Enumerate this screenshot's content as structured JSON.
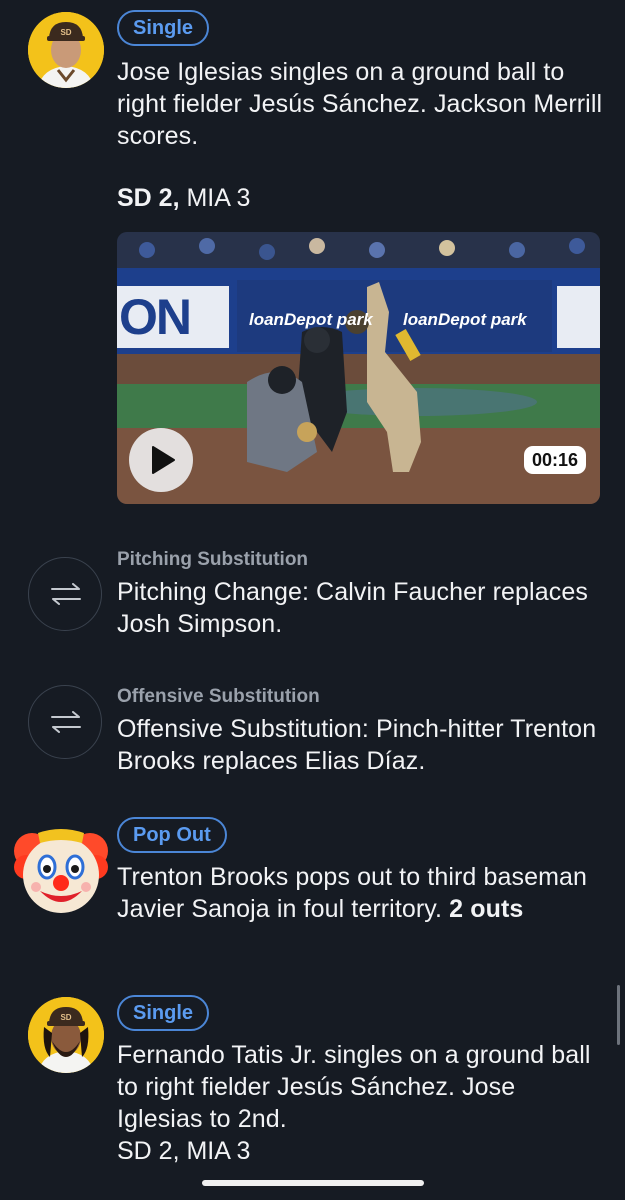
{
  "events": [
    {
      "badge": "Single",
      "description": "Jose Iglesias singles on a ground ball to right fielder Jesús Sánchez. Jackson Merrill scores.",
      "score_sd": "SD 2,",
      "score_mia": "MIA 3",
      "player_avatar": "padres-player-avatar",
      "video": {
        "duration": "00:16",
        "stadium_sign_1": "loanDepot park",
        "stadium_sign_2": "loanDepot park",
        "wall_text": "ON"
      }
    },
    {
      "label": "Pitching Substitution",
      "description": "Pitching Change: Calvin Faucher replaces Josh Simpson.",
      "icon": "swap-arrows-icon"
    },
    {
      "label": "Offensive Substitution",
      "description": "Offensive Substitution: Pinch-hitter Trenton Brooks replaces Elias Díaz.",
      "icon": "swap-arrows-icon"
    },
    {
      "badge": "Pop Out",
      "description": "Trenton Brooks pops out to third baseman Javier Sanoja in foul territory.",
      "outs": "2 outs",
      "icon": "clown-face-icon"
    },
    {
      "badge": "Single",
      "description": "Fernando Tatis Jr. singles on a ground ball to right fielder Jesús Sánchez. Jose Iglesias to 2nd.",
      "score": "SD 2, MIA 3",
      "player_avatar": "padres-player-avatar"
    }
  ],
  "colors": {
    "background": "#161b23",
    "badge_blue": "#4b86d6",
    "avatar_gold": "#f3c21a",
    "muted_text": "#9aa1ab"
  }
}
